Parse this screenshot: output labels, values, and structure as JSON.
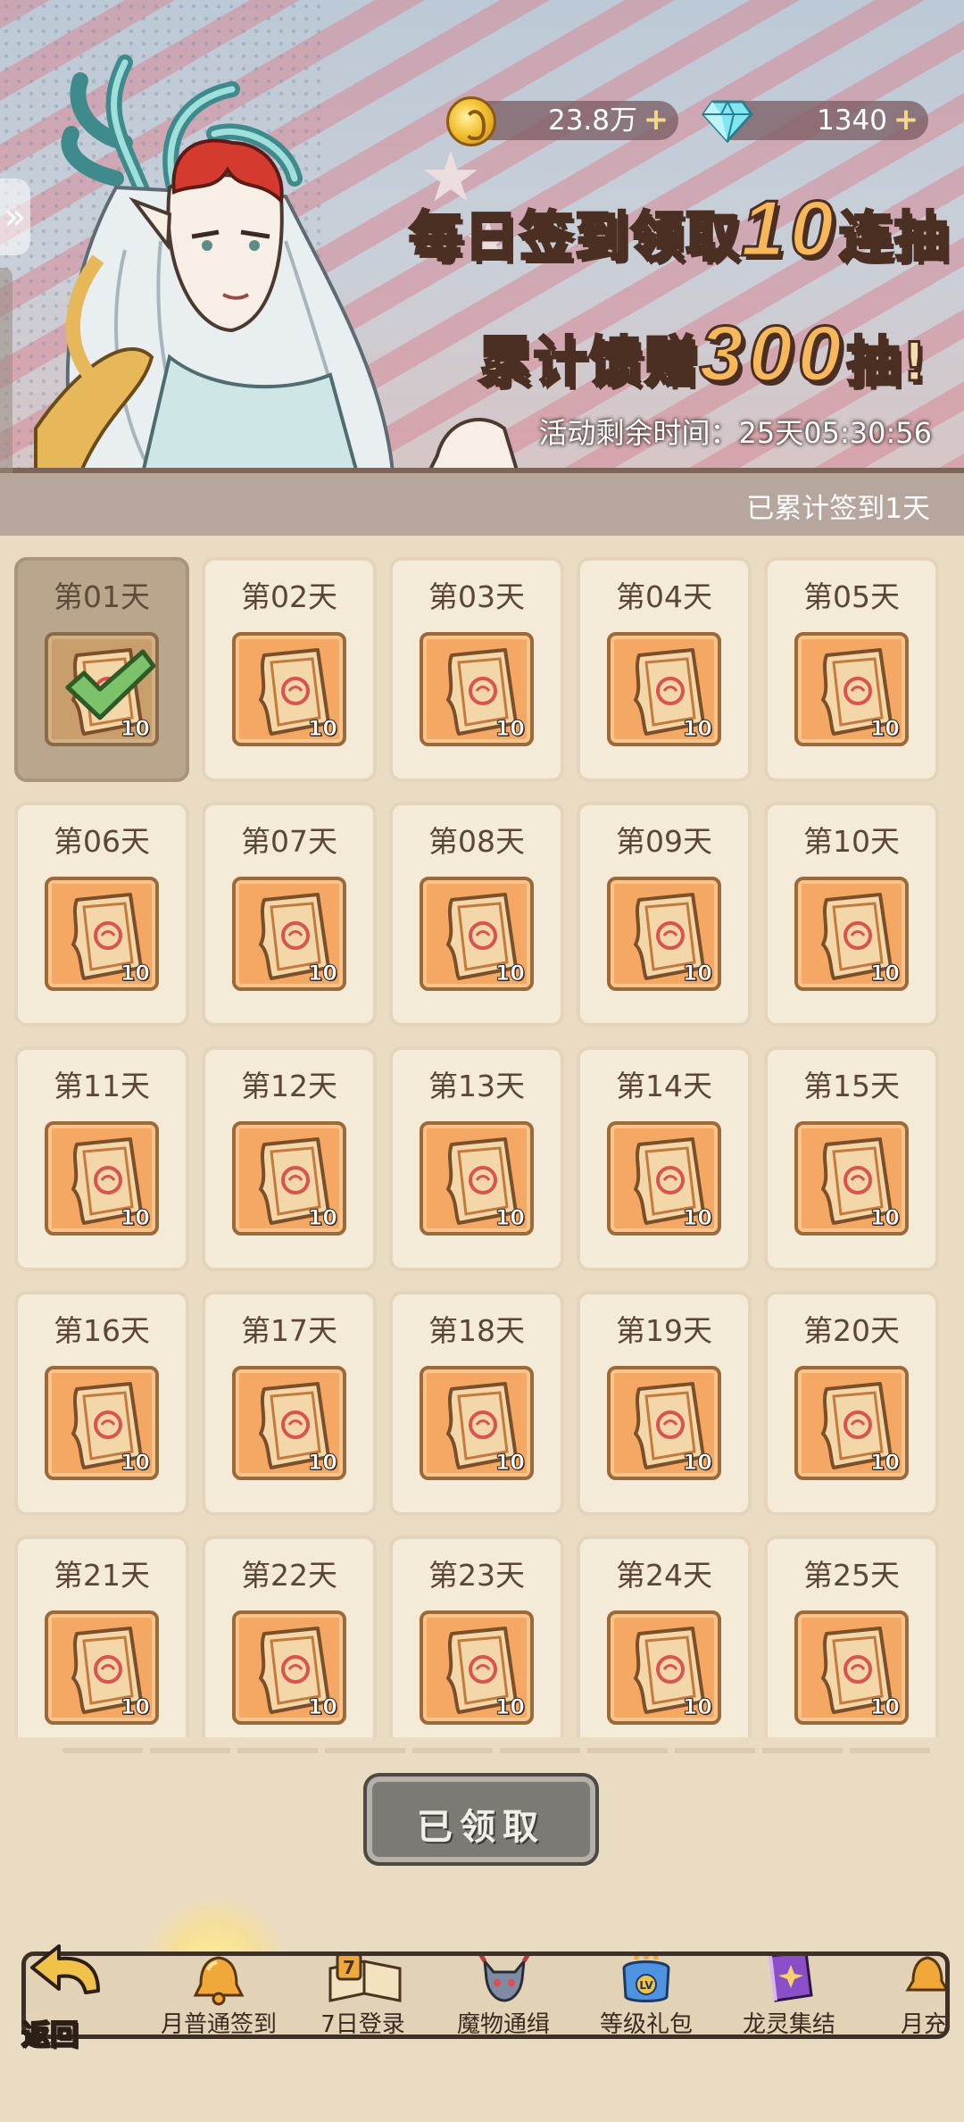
{
  "currency": {
    "coins": "23.8万",
    "gems": "1340"
  },
  "banner": {
    "line1_prefix": "每日签到领取",
    "line1_big": "10",
    "line1_suffix": "连抽",
    "line2_prefix": "累计馈赠",
    "line2_big": "300",
    "line2_suffix": "抽!",
    "timer": "活动剩余时间：25天05:30:56"
  },
  "signin_count": "已累计签到1天",
  "days": [
    {
      "label": "第01天",
      "qty": "10",
      "claimed": true
    },
    {
      "label": "第02天",
      "qty": "10"
    },
    {
      "label": "第03天",
      "qty": "10"
    },
    {
      "label": "第04天",
      "qty": "10"
    },
    {
      "label": "第05天",
      "qty": "10"
    },
    {
      "label": "第06天",
      "qty": "10"
    },
    {
      "label": "第07天",
      "qty": "10"
    },
    {
      "label": "第08天",
      "qty": "10"
    },
    {
      "label": "第09天",
      "qty": "10"
    },
    {
      "label": "第10天",
      "qty": "10"
    },
    {
      "label": "第11天",
      "qty": "10"
    },
    {
      "label": "第12天",
      "qty": "10"
    },
    {
      "label": "第13天",
      "qty": "10"
    },
    {
      "label": "第14天",
      "qty": "10"
    },
    {
      "label": "第15天",
      "qty": "10"
    },
    {
      "label": "第16天",
      "qty": "10"
    },
    {
      "label": "第17天",
      "qty": "10"
    },
    {
      "label": "第18天",
      "qty": "10"
    },
    {
      "label": "第19天",
      "qty": "10"
    },
    {
      "label": "第20天",
      "qty": "10"
    },
    {
      "label": "第21天",
      "qty": "10"
    },
    {
      "label": "第22天",
      "qty": "10"
    },
    {
      "label": "第23天",
      "qty": "10"
    },
    {
      "label": "第24天",
      "qty": "10"
    },
    {
      "label": "第25天",
      "qty": "10"
    }
  ],
  "claim_button": "已领取",
  "nav": {
    "back": "返回",
    "items": [
      "月普通签到",
      "7日登录",
      "魔物通缉",
      "等级礼包",
      "龙灵集结",
      "月充"
    ],
    "calendar_number": "7",
    "level_badge": "LV"
  },
  "colors": {
    "ticket_bg": "#f5a863",
    "claimed_bg": "#b9a68d",
    "headline_big": "#f6b85b"
  }
}
